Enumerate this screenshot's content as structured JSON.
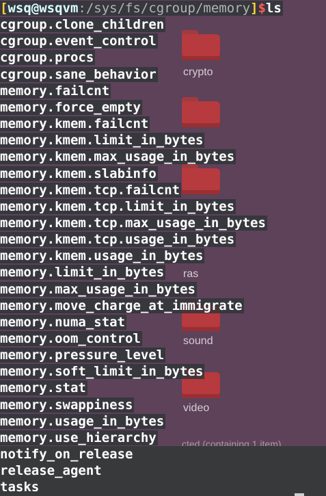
{
  "desktop": {
    "folders": [
      {
        "label": ""
      },
      {
        "label": "crypto"
      },
      {
        "label": ""
      },
      {
        "label": "ras"
      },
      {
        "label": "sound"
      },
      {
        "label": "video"
      }
    ],
    "status_text": "cted (containing 1 item)",
    "folder_color": "#b63a3e",
    "background_color": "#5d4259"
  },
  "terminal": {
    "prompt": {
      "open_bracket": "[",
      "user_host": "wsq@wsqvm",
      "path": ":/sys/fs/cgroup/memory",
      "close_bracket": "]",
      "dollar": "$",
      "command": "ls"
    },
    "files": [
      "cgroup.clone_children",
      "cgroup.event_control",
      "cgroup.procs",
      "cgroup.sane_behavior",
      "memory.failcnt",
      "memory.force_empty",
      "memory.kmem.failcnt",
      "memory.kmem.limit_in_bytes",
      "memory.kmem.max_usage_in_bytes",
      "memory.kmem.slabinfo",
      "memory.kmem.tcp.failcnt",
      "memory.kmem.tcp.limit_in_bytes",
      "memory.kmem.tcp.max_usage_in_bytes",
      "memory.kmem.tcp.usage_in_bytes",
      "memory.kmem.usage_in_bytes",
      "memory.limit_in_bytes",
      "memory.max_usage_in_bytes",
      "memory.move_charge_at_immigrate",
      "memory.numa_stat",
      "memory.oom_control",
      "memory.pressure_level",
      "memory.soft_limit_in_bytes",
      "memory.stat",
      "memory.swappiness",
      "memory.usage_in_bytes",
      "memory.use_hierarchy",
      "notify_on_release",
      "release_agent",
      "tasks"
    ],
    "colors": {
      "bracket": "#ffd23a",
      "user_host": "#d9ffff",
      "dollar": "#ff5a5a",
      "text": "#ffffff"
    }
  }
}
